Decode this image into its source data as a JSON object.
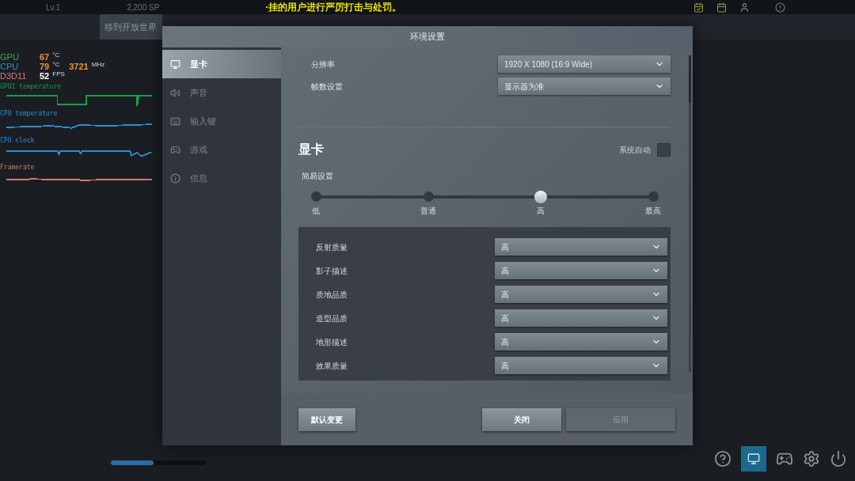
{
  "top_bar": {
    "level": "Lv.1",
    "points": "2,200 SP",
    "notice": "·挂的用户进行严厉打击与处罚。"
  },
  "nav": {
    "tab": "移到开放世界"
  },
  "session_progress": {
    "level": 0.45
  },
  "overlay": {
    "stats": [
      {
        "label": "GPU",
        "color": "#2fa84f",
        "kind": "sensor",
        "value": "67",
        "unit": "°C"
      },
      {
        "label": "CPU",
        "color": "#2a8fd0",
        "kind": "sensor",
        "value": "79",
        "unit": "°C",
        "extra": "3721",
        "extra_unit": "MHz"
      },
      {
        "label": "D3D11",
        "color": "#d27a72",
        "kind": "api",
        "value": "52",
        "unit": "FPS"
      }
    ],
    "graphs": [
      {
        "label": "GPU1 temperature",
        "color": "#1f9a4a"
      },
      {
        "label": "CPU temperature",
        "color": "#2a8fd0"
      },
      {
        "label": "CPU clock",
        "color": "#2a8fd0"
      },
      {
        "label": "Framerate",
        "color": "#d07a70"
      }
    ]
  },
  "dialog": {
    "title": "环境设置",
    "sidebar": [
      {
        "label": "显卡",
        "selected": true
      },
      {
        "label": "声音",
        "selected": false
      },
      {
        "label": "输入键",
        "selected": false
      },
      {
        "label": "游戏",
        "selected": false
      },
      {
        "label": "信息",
        "selected": false
      }
    ],
    "display": [
      {
        "label": "分辨率",
        "value": "1920 X 1080 (16:9 Wide)"
      },
      {
        "label": "帧数设置",
        "value": "显示器为准"
      }
    ],
    "section": {
      "title": "显卡",
      "auto": {
        "label": "系统自动",
        "checked": false
      },
      "preset": {
        "label": "简易设置",
        "level": 0.667,
        "stops": [
          "低",
          "普通",
          "高",
          "最高"
        ]
      }
    },
    "quality": [
      {
        "label": "反射质量",
        "value": "高"
      },
      {
        "label": "影子描述",
        "value": "高"
      },
      {
        "label": "质地品质",
        "value": "高"
      },
      {
        "label": "造型品质",
        "value": "高"
      },
      {
        "label": "地形描述",
        "value": "高"
      },
      {
        "label": "效果质量",
        "value": "高"
      }
    ],
    "buttons": [
      {
        "label": "默认变更",
        "kind": "secondary",
        "disabled": false
      },
      {
        "label": "关闭",
        "kind": "primary",
        "disabled": false
      },
      {
        "label": "应用",
        "kind": "primary",
        "disabled": true
      }
    ]
  }
}
